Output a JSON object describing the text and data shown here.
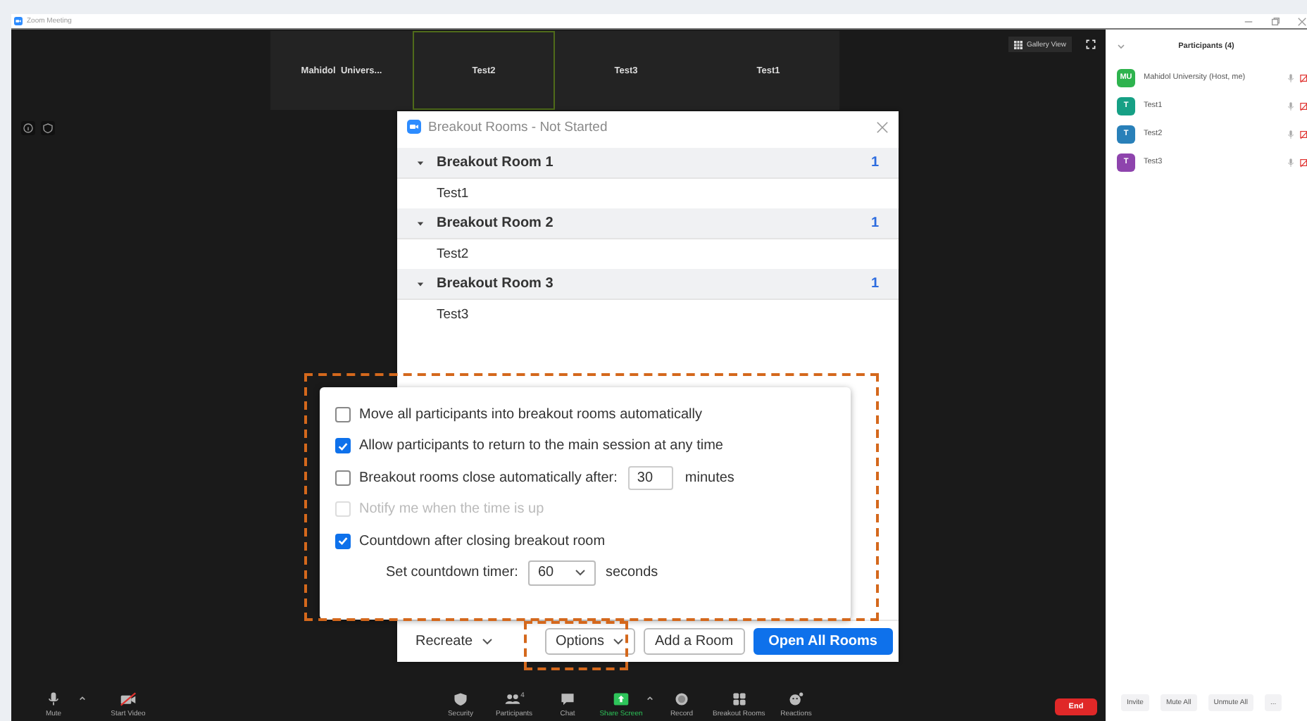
{
  "titlebar": {
    "title": "Zoom Meeting"
  },
  "gallery": {
    "tiles": [
      {
        "name": "Mahidol  Univers...",
        "selected": false
      },
      {
        "name": "Test2",
        "selected": true
      },
      {
        "name": "Test3",
        "selected": false
      },
      {
        "name": "Test1",
        "selected": false
      }
    ],
    "view_button": "Gallery View"
  },
  "breakout_dialog": {
    "title": "Breakout Rooms - Not Started",
    "rooms": [
      {
        "name": "Breakout Room 1",
        "count": "1",
        "expanded": true,
        "members": [
          "Test1"
        ]
      },
      {
        "name": "Breakout Room 2",
        "count": "1",
        "expanded": true,
        "members": [
          "Test2"
        ]
      },
      {
        "name": "Breakout Room 3",
        "count": "1",
        "expanded": true,
        "members": [
          "Test3"
        ]
      }
    ],
    "footer": {
      "recreate": "Recreate",
      "options": "Options",
      "add_room": "Add a Room",
      "open_all": "Open All Rooms"
    }
  },
  "options_menu": {
    "items": [
      {
        "kind": "checkbox",
        "label": "Move all participants into breakout rooms automatically",
        "checked": false,
        "disabled": false
      },
      {
        "kind": "checkbox",
        "label": "Allow participants to return to the main session at any time",
        "checked": true,
        "disabled": false
      },
      {
        "kind": "checkbox_input",
        "label": "Breakout rooms close automatically after:",
        "checked": false,
        "disabled": false,
        "value": "30",
        "suffix": "minutes"
      },
      {
        "kind": "checkbox",
        "label": "Notify me when the time is up",
        "checked": false,
        "disabled": true
      },
      {
        "kind": "checkbox",
        "label": "Countdown after closing breakout room",
        "checked": true,
        "disabled": false
      },
      {
        "kind": "select",
        "label": "Set countdown timer:",
        "value": "60",
        "suffix": "seconds"
      }
    ]
  },
  "toolbar": {
    "left": [
      {
        "kind": "mic",
        "label": "Mute",
        "caret": true
      },
      {
        "kind": "video_off",
        "label": "Start Video",
        "caret": false
      }
    ],
    "center": [
      {
        "kind": "shield",
        "label": "Security",
        "caret": false
      },
      {
        "kind": "people",
        "label": "Participants",
        "count": "4",
        "caret": false
      },
      {
        "kind": "chat",
        "label": "Chat",
        "caret": false
      },
      {
        "kind": "share",
        "label": "Share Screen",
        "caret": true
      },
      {
        "kind": "record",
        "label": "Record",
        "caret": false
      },
      {
        "kind": "grid",
        "label": "Breakout Rooms",
        "caret": false
      },
      {
        "kind": "reaction",
        "label": "Reactions",
        "caret": false
      }
    ],
    "end": "End"
  },
  "participants_panel": {
    "title": "Participants (4)",
    "people": [
      {
        "initials": "MU",
        "name": "Mahidol University (Host, me)",
        "color": "#2eb34e"
      },
      {
        "initials": "T",
        "name": "Test1",
        "color": "#16a085"
      },
      {
        "initials": "T",
        "name": "Test2",
        "color": "#2980b9"
      },
      {
        "initials": "T",
        "name": "Test3",
        "color": "#8e44ad"
      }
    ],
    "buttons": [
      "Invite",
      "Mute All",
      "Unmute All",
      "..."
    ]
  }
}
